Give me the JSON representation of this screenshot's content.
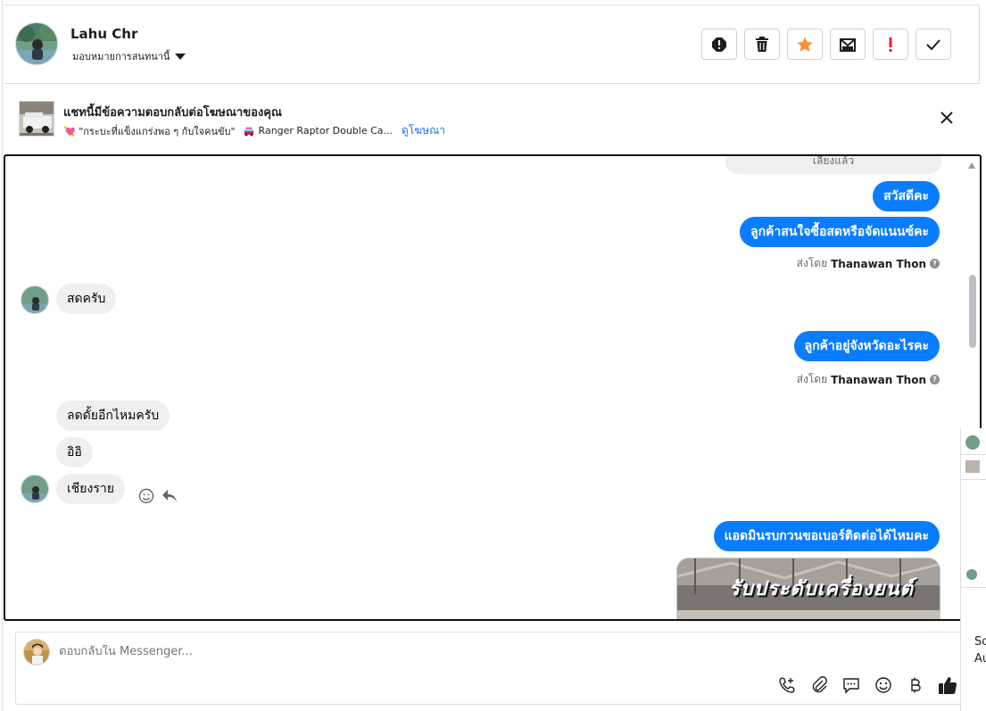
{
  "header": {
    "contact_name": "Lahu Chr",
    "assign_label": "มอบหมายการสนทนานี้",
    "actions": [
      "report-icon",
      "trash-icon",
      "star-icon",
      "move-icon",
      "priority-icon",
      "check-icon"
    ],
    "accent_orange": "#f7923a",
    "alert_red": "#e41e3f"
  },
  "ad": {
    "title": "แชทนี้มีข้อความตอบกลับต่อโฆษณาของคุณ",
    "ad_quote": "💘 \"กระบะที่แข็งแกร่งพอ ๆ กับใจคนขับ\"",
    "ad_product": "Ranger Raptor Double Ca...",
    "view_ad_link": "ดูโฆษณา"
  },
  "thread": {
    "top_partial_text": "เลี้ยงแล้ว",
    "messages": [
      {
        "direction": "out",
        "text": "สวัสดีคะ"
      },
      {
        "direction": "out",
        "text": "ลูกค้าสนใจซื้อสดหรือจัดแนนซ์คะ"
      },
      {
        "direction": "in",
        "text": "สดครับ"
      },
      {
        "direction": "out",
        "text": "ลูกค้าอยู่จังหวัดอะไรคะ"
      },
      {
        "direction": "in",
        "text": "ลดดั้ยอีกไหมครับ"
      },
      {
        "direction": "in",
        "text": "อิอิ"
      },
      {
        "direction": "in",
        "text": "เชียงราย"
      },
      {
        "direction": "out",
        "text": "แอดมินรบกวนขอเบอร์ติดต่อได้ไหมคะ"
      }
    ],
    "sent_by_prefix": "ส่งโดย",
    "sent_by_name": "Thanawan Thon",
    "image_text": "รับประดับเครื่องยนต์",
    "bubble_blue": "#0a7cff",
    "bubble_gray": "#eeeff1"
  },
  "composer": {
    "placeholder": "ตอบกลับใน Messenger...",
    "tools": [
      "add-call-icon",
      "paperclip-icon",
      "saved-reply-icon",
      "emoji-icon",
      "baht-icon",
      "like-icon"
    ],
    "like_blue": "#0a7cff"
  },
  "peek": {
    "text_1": "So",
    "text_2": "Au"
  }
}
